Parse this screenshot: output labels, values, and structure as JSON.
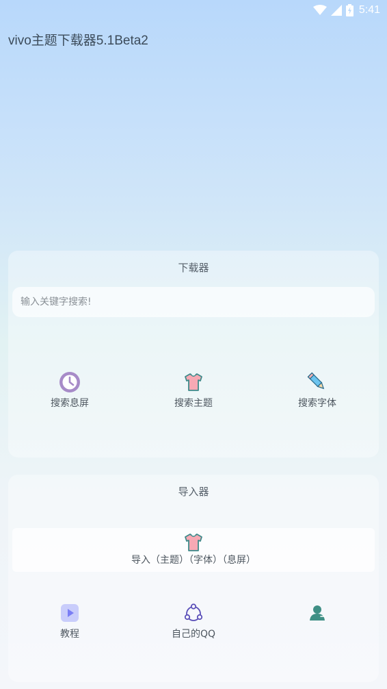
{
  "status_bar": {
    "time": "5:41",
    "icons": [
      "wifi-icon",
      "signal-icon",
      "battery-charging-icon"
    ]
  },
  "app": {
    "title": "vivo主题下载器5.1Beta2"
  },
  "downloader": {
    "title": "下载器",
    "search": {
      "placeholder": "输入关键字搜索!",
      "value": ""
    },
    "actions": [
      {
        "label": "搜索息屏",
        "icon": "clock-icon"
      },
      {
        "label": "搜索主题",
        "icon": "tshirt-icon"
      },
      {
        "label": "搜索字体",
        "icon": "pencil-icon"
      }
    ]
  },
  "importer": {
    "title": "导入器",
    "import_button": {
      "label": "导入（主题）（字体）（息屏）",
      "icon": "tshirt-icon"
    },
    "actions": [
      {
        "label": "教程",
        "icon": "play-icon"
      },
      {
        "label": "自己的QQ",
        "icon": "share-icon"
      },
      {
        "label": "",
        "icon": "user-icon"
      }
    ]
  },
  "colors": {
    "accent_purple": "#a78bc8",
    "tshirt_pink": "#f7a9b4",
    "tshirt_outline": "#3d8a8a",
    "play_blue": "#7a7ef5",
    "share_indigo": "#5a4fb8",
    "user_teal": "#3f8f85"
  }
}
